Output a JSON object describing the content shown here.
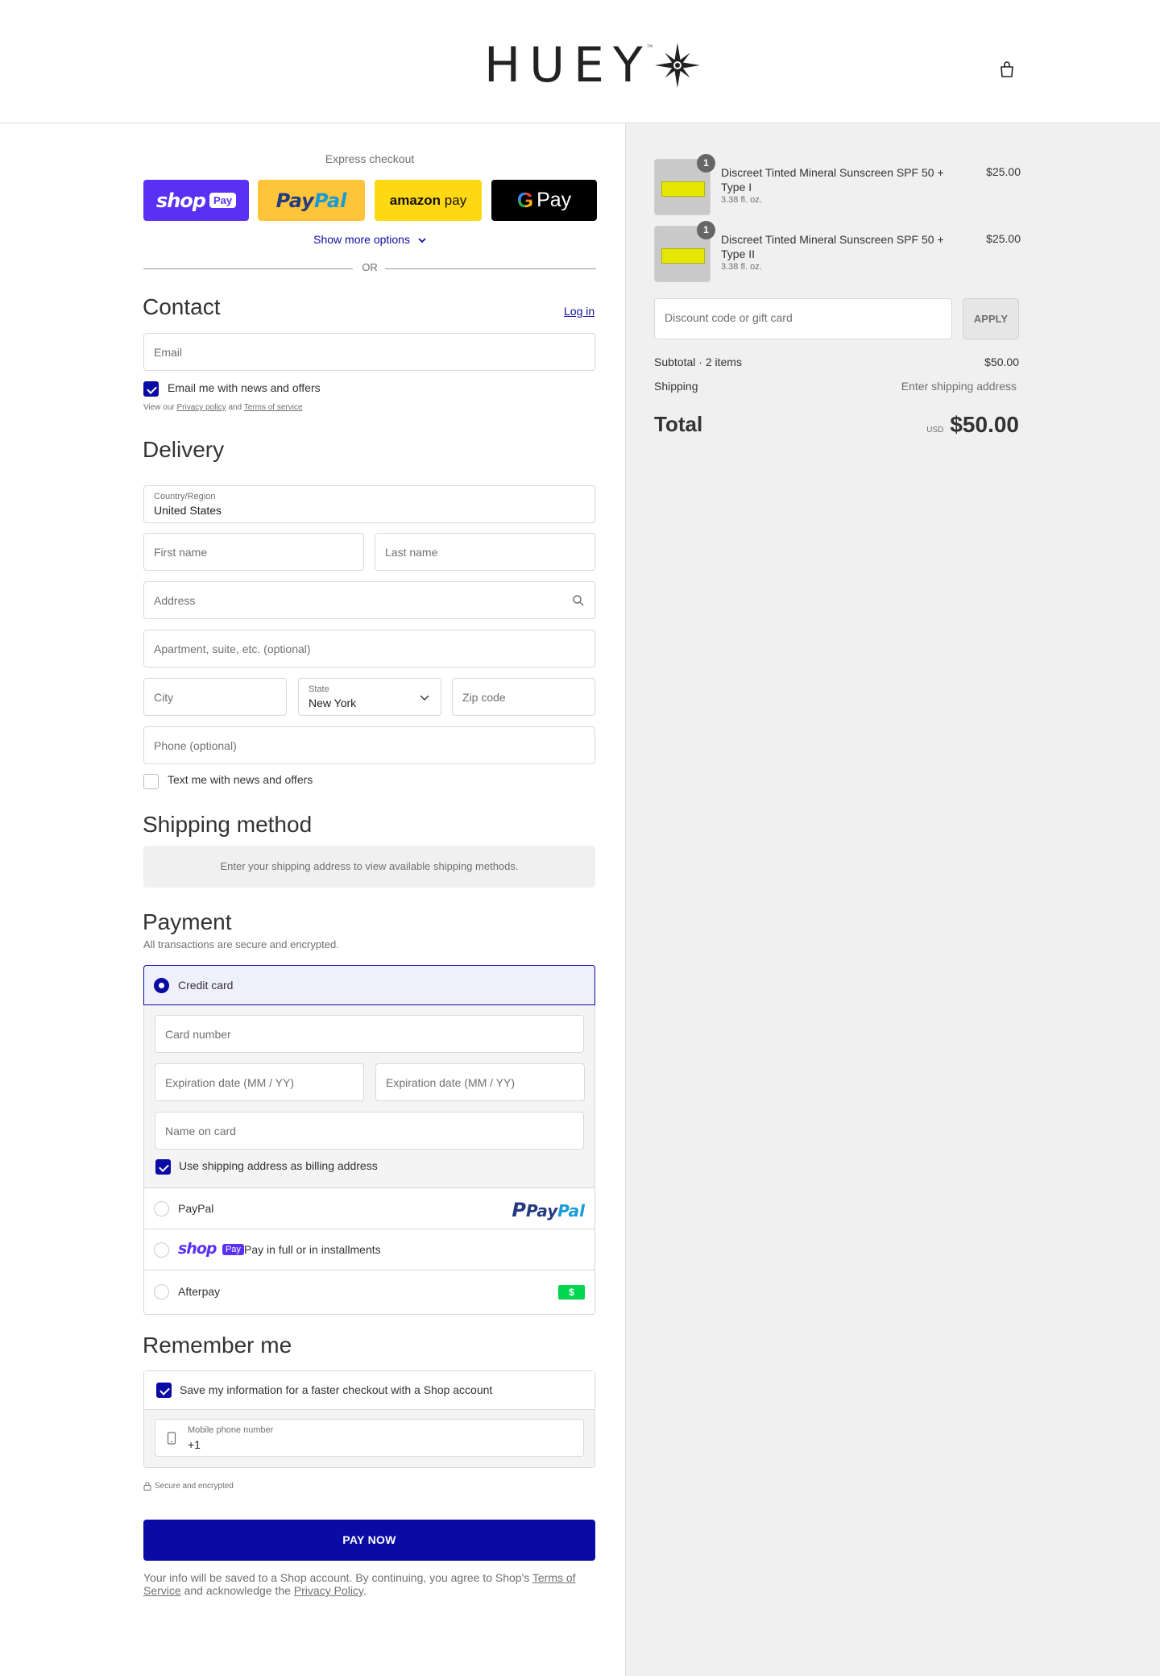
{
  "header": {
    "brand": "HUEY",
    "tm": "™"
  },
  "express": {
    "title": "Express checkout",
    "shop_pay": {
      "shop": "shop",
      "pay": "Pay"
    },
    "paypal": {
      "p1": "Pay",
      "p2": "Pal"
    },
    "amazon": {
      "a": "amazon",
      "b": "pay"
    },
    "gpay": {
      "g": "G",
      "pay": "Pay"
    },
    "show_more": "Show more options",
    "or": "OR"
  },
  "contact": {
    "title": "Contact",
    "login": "Log in",
    "email_placeholder": "Email",
    "news_label": "Email me with news and offers",
    "privacy_prefix": "View our",
    "privacy": "Privacy policy",
    "and": "and",
    "terms": "Terms of service"
  },
  "delivery": {
    "title": "Delivery",
    "country_label": "Country/Region",
    "country": "United States",
    "first_name": "First name",
    "last_name": "Last name",
    "address": "Address",
    "apartment": "Apartment, suite, etc. (optional)",
    "city": "City",
    "state_label": "State",
    "state": "New York",
    "zip": "Zip code",
    "phone": "Phone (optional)",
    "text_label": "Text me with news and offers"
  },
  "shipping_method": {
    "title": "Shipping method",
    "message": "Enter your shipping address to view available shipping methods."
  },
  "payment": {
    "title": "Payment",
    "subtitle": "All transactions are secure and encrypted.",
    "credit_card": "Credit card",
    "card_number": "Card number",
    "expiration": "Expiration date (MM / YY)",
    "expiration2": "Expiration date (MM / YY)",
    "name_on_card": "Name on card",
    "billing_label": "Use shipping address as billing address",
    "paypal": "PayPal",
    "paypal_logo": {
      "p1": "Pay",
      "p2": "Pal"
    },
    "shop_pay_shop": "shop",
    "shop_pay_pay": "Pay",
    "shop_pay_label": "Pay in full or in installments",
    "afterpay": "Afterpay",
    "afterpay_badge": "$"
  },
  "remember": {
    "title": "Remember me",
    "save_label": "Save my information for a faster checkout with a Shop account",
    "mobile_label": "Mobile phone number",
    "mobile_value": "+1"
  },
  "secure": "Secure and encrypted",
  "pay_now": "PAY NOW",
  "legal": {
    "a": "Your info will be saved to a Shop account. By continuing, you agree to Shop's",
    "terms": "Terms of Service",
    "b": "and acknowledge the",
    "privacy": "Privacy Policy",
    "c": "."
  },
  "summary": {
    "items": [
      {
        "qty": "1",
        "name": "Discreet Tinted Mineral Sunscreen SPF 50 + Type I",
        "variant": "3.38 fl. oz.",
        "price": "$25.00"
      },
      {
        "qty": "1",
        "name": "Discreet Tinted Mineral Sunscreen SPF 50 + Type II",
        "variant": "3.38 fl. oz.",
        "price": "$25.00"
      }
    ],
    "discount_placeholder": "Discount code or gift card",
    "apply": "APPLY",
    "subtotal_label": "Subtotal · 2 items",
    "subtotal": "$50.00",
    "shipping_label": "Shipping",
    "shipping_value": "Enter shipping address",
    "total_label": "Total",
    "currency": "USD",
    "total": "$50.00"
  },
  "colors": {
    "accent": "#0a0aa5",
    "shop_purple": "#5a31f4",
    "paypal_yellow": "#ffc439",
    "amazon_yellow": "#ffd814",
    "afterpay_green": "#00d64f"
  }
}
